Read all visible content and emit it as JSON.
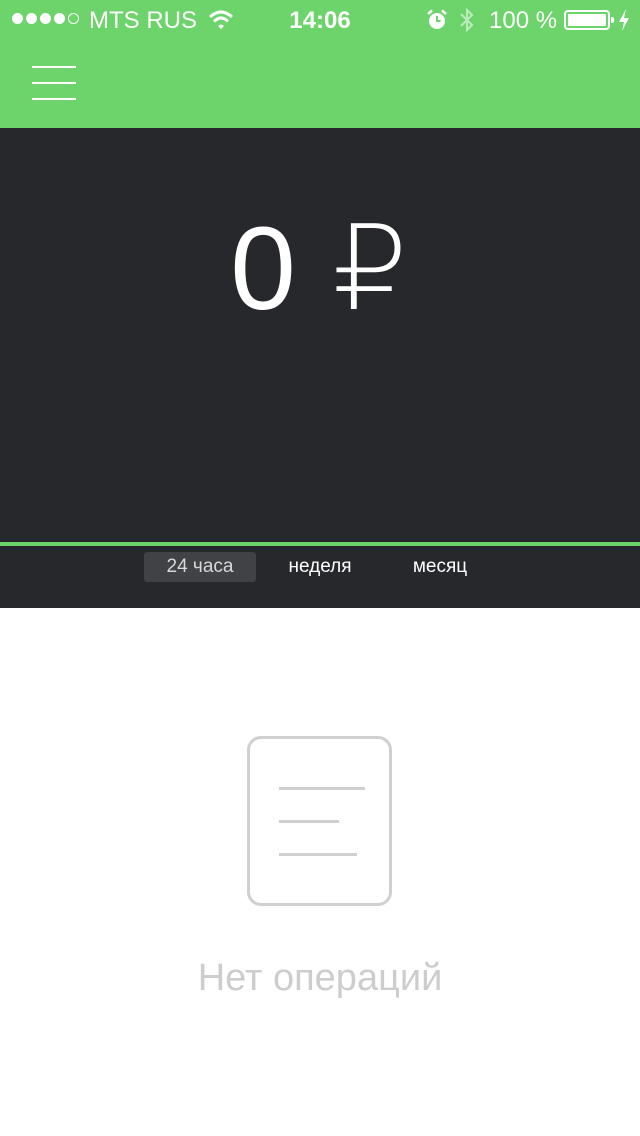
{
  "status_bar": {
    "carrier": "MTS RUS",
    "time": "14:06",
    "battery_percent": "100 %",
    "battery_level": 1.0,
    "signal_bars_filled": 4,
    "signal_bars_total": 5,
    "icons": [
      "wifi-icon",
      "alarm-icon",
      "bluetooth-icon",
      "battery-icon",
      "charging-bolt-icon"
    ]
  },
  "header": {
    "menu_icon": "hamburger-menu-icon"
  },
  "summary": {
    "amount": "0",
    "currency": "₽"
  },
  "period_tabs": [
    {
      "label": "24 часа",
      "active": true
    },
    {
      "label": "неделя",
      "active": false
    },
    {
      "label": "месяц",
      "active": false
    }
  ],
  "empty_state": {
    "icon": "document-icon",
    "text": "Нет операций"
  },
  "colors": {
    "accent": "#6dd46b",
    "dark_panel": "#27282c",
    "active_tab": "#414245",
    "muted": "#cdcdcd"
  }
}
